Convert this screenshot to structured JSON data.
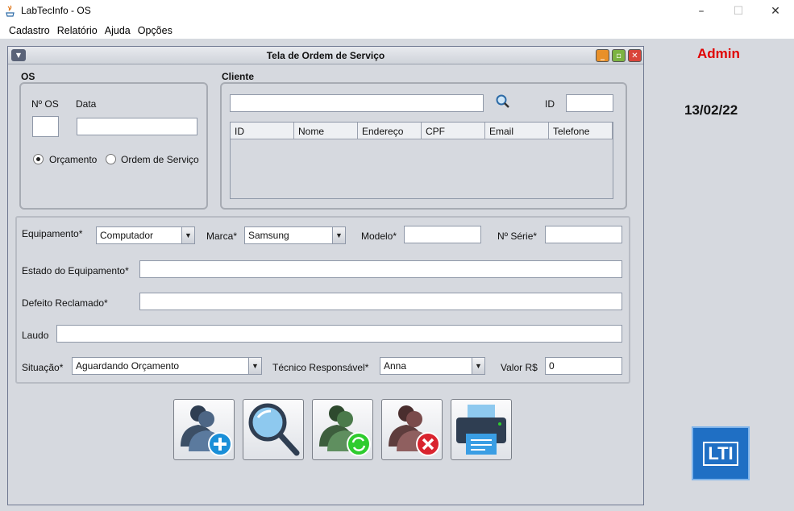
{
  "window": {
    "title": "LabTecInfo - OS",
    "minimize": "–",
    "maximize": "☐",
    "close": "✕"
  },
  "menu": [
    "Cadastro",
    "Relatório",
    "Ajuda",
    "Opções"
  ],
  "frame": {
    "title": "Tela de Ordem de Serviço"
  },
  "os_group": {
    "title": "OS",
    "num_label": "Nº OS",
    "date_label": "Data",
    "num_value": "",
    "date_value": "",
    "radio_orcamento": "Orçamento",
    "radio_ordem": "Ordem de Serviço",
    "selected": "Orçamento"
  },
  "cliente_group": {
    "title": "Cliente",
    "search_value": "",
    "id_label": "ID",
    "id_value": "",
    "columns": [
      "ID",
      "Nome",
      "Endereço",
      "CPF",
      "Email",
      "Telefone"
    ]
  },
  "equip": {
    "equip_label": "Equipamento*",
    "equip_value": "Computador",
    "marca_label": "Marca*",
    "marca_value": "Samsung",
    "modelo_label": "Modelo*",
    "modelo_value": "",
    "serie_label": "Nº Série*",
    "serie_value": "",
    "estado_label": "Estado do Equipamento*",
    "estado_value": "",
    "defeito_label": "Defeito Reclamado*",
    "defeito_value": "",
    "laudo_label": "Laudo",
    "laudo_value": "",
    "situacao_label": "Situação*",
    "situacao_value": "Aguardando Orçamento",
    "tecnico_label": "Técnico Responsável*",
    "tecnico_value": "Anna",
    "valor_label": "Valor R$",
    "valor_value": "0"
  },
  "buttons": [
    "add-os-icon",
    "search-os-icon",
    "update-os-icon",
    "delete-os-icon",
    "print-os-icon"
  ],
  "sidebar": {
    "user": "Admin",
    "date": "13/02/22",
    "logo_text": "LTI"
  },
  "colors": {
    "desktop": "#d6d9df",
    "admin": "#e00000",
    "logo": "#1f6fc4"
  }
}
